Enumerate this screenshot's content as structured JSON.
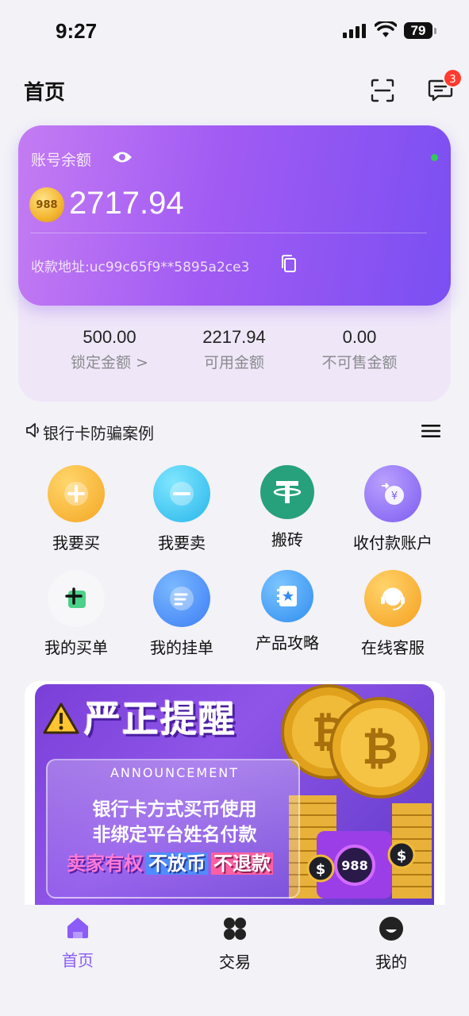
{
  "status_bar": {
    "time": "9:27",
    "battery": "79"
  },
  "header": {
    "title": "首页",
    "badge_count": "3"
  },
  "balance": {
    "label": "账号余额",
    "value": "2717.94",
    "address": "收款地址:uc99c65f9**5895a2ce3",
    "coin_text": "988"
  },
  "stats": [
    {
      "value": "500.00",
      "label": "锁定金额 >"
    },
    {
      "value": "2217.94",
      "label": "可用金额"
    },
    {
      "value": "0.00",
      "label": "不可售金额"
    }
  ],
  "notice": {
    "text": "银行卡防骗案例"
  },
  "grid": [
    {
      "label": "我要买",
      "icon": "buy-icon",
      "color": "#f7b731"
    },
    {
      "label": "我要卖",
      "icon": "sell-icon",
      "color": "#3cc8f0"
    },
    {
      "label": "搬砖",
      "icon": "tether-icon",
      "color": "#26a17b"
    },
    {
      "label": "收付款账户",
      "icon": "payment-account-icon",
      "color": "#8e6cf0"
    },
    {
      "label": "我的买单",
      "icon": "my-buy-orders-icon",
      "color": "#f4f4f6"
    },
    {
      "label": "我的挂单",
      "icon": "my-sell-orders-icon",
      "color": "#4c8df6"
    },
    {
      "label": "产品攻略",
      "icon": "guide-icon",
      "color": "#3b9cf2"
    },
    {
      "label": "在线客服",
      "icon": "customer-service-icon",
      "color": "#f9b82f"
    }
  ],
  "banner": {
    "title": "严正提醒",
    "announcement": "ANNOUNCEMENT",
    "line1": "银行卡方式买币使用",
    "line2": "非绑定平台姓名付款",
    "line3_a": "卖家有权",
    "line3_b": "不放币",
    "line3_c": "不退款"
  },
  "tabbar": [
    {
      "label": "首页",
      "active": true
    },
    {
      "label": "交易",
      "active": false
    },
    {
      "label": "我的",
      "active": false
    }
  ],
  "colors": {
    "accent": "#8b5cf6",
    "card_start": "#c47cf3",
    "card_end": "#7a4ff2"
  }
}
